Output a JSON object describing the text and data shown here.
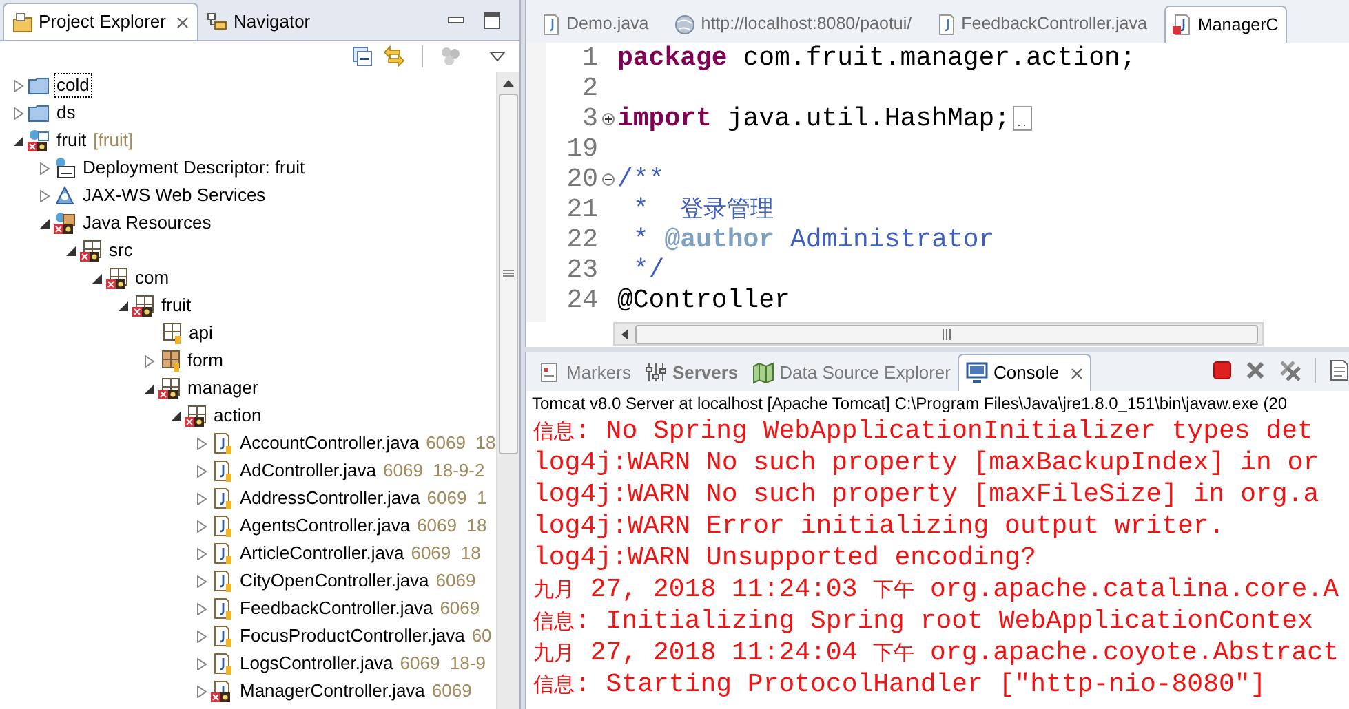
{
  "explorer": {
    "tabs": [
      {
        "label": "Project Explorer",
        "kind": "explorer",
        "selected": true,
        "closable": true
      },
      {
        "label": "Navigator",
        "kind": "navigator",
        "selected": false,
        "closable": false
      }
    ],
    "tree": [
      {
        "label": "cold",
        "kind": "folder",
        "has_children": true,
        "expanded": false,
        "focused": true,
        "error": false
      },
      {
        "label": "ds",
        "kind": "folder",
        "has_children": true,
        "expanded": false,
        "focused": false,
        "error": false
      },
      {
        "label": "fruit",
        "suffix": "[fruit]",
        "kind": "project",
        "has_children": true,
        "expanded": true,
        "focused": false,
        "error": true,
        "children": [
          {
            "label": "Deployment Descriptor: fruit",
            "kind": "descriptor",
            "has_children": true,
            "expanded": false,
            "focused": false,
            "error": false
          },
          {
            "label": "JAX-WS Web Services",
            "kind": "services",
            "has_children": true,
            "expanded": false,
            "focused": false,
            "error": false
          },
          {
            "label": "Java Resources",
            "kind": "resources",
            "has_children": true,
            "expanded": true,
            "focused": false,
            "error": true,
            "children": [
              {
                "label": "src",
                "kind": "package",
                "has_children": true,
                "expanded": true,
                "focused": false,
                "error": true,
                "children": [
                  {
                    "label": "com",
                    "kind": "package",
                    "has_children": true,
                    "expanded": true,
                    "focused": false,
                    "error": true,
                    "children": [
                      {
                        "label": "fruit",
                        "kind": "package",
                        "has_children": true,
                        "expanded": true,
                        "focused": false,
                        "error": true,
                        "children": [
                          {
                            "label": "api",
                            "kind": "package",
                            "has_children": false,
                            "focused": false,
                            "error": false
                          },
                          {
                            "label": "form",
                            "kind": "package",
                            "has_children": true,
                            "expanded": false,
                            "focused": false,
                            "error": false
                          },
                          {
                            "label": "manager",
                            "kind": "package",
                            "has_children": true,
                            "expanded": true,
                            "focused": false,
                            "error": true,
                            "children": [
                              {
                                "label": "action",
                                "kind": "package",
                                "has_children": true,
                                "expanded": true,
                                "focused": false,
                                "error": true,
                                "children": [
                                  {
                                    "label": "AccountController.java",
                                    "suffix": "6069  18",
                                    "kind": "file",
                                    "has_children": true,
                                    "expanded": false,
                                    "focused": false,
                                    "error": false
                                  },
                                  {
                                    "label": "AdController.java",
                                    "suffix": "6069  18-9-2",
                                    "kind": "file",
                                    "has_children": true,
                                    "expanded": false,
                                    "focused": false,
                                    "error": false
                                  },
                                  {
                                    "label": "AddressController.java",
                                    "suffix": "6069  1",
                                    "kind": "file",
                                    "has_children": true,
                                    "expanded": false,
                                    "focused": false,
                                    "error": false
                                  },
                                  {
                                    "label": "AgentsController.java",
                                    "suffix": "6069  18",
                                    "kind": "file",
                                    "has_children": true,
                                    "expanded": false,
                                    "focused": false,
                                    "error": false
                                  },
                                  {
                                    "label": "ArticleController.java",
                                    "suffix": "6069  18",
                                    "kind": "file",
                                    "has_children": true,
                                    "expanded": false,
                                    "focused": false,
                                    "error": false
                                  },
                                  {
                                    "label": "CityOpenController.java",
                                    "suffix": "6069",
                                    "kind": "file",
                                    "has_children": true,
                                    "expanded": false,
                                    "focused": false,
                                    "error": false
                                  },
                                  {
                                    "label": "FeedbackController.java",
                                    "suffix": "6069",
                                    "kind": "file",
                                    "has_children": true,
                                    "expanded": false,
                                    "focused": false,
                                    "error": false
                                  },
                                  {
                                    "label": "FocusProductController.java",
                                    "suffix": "60",
                                    "kind": "file",
                                    "has_children": true,
                                    "expanded": false,
                                    "focused": false,
                                    "error": false
                                  },
                                  {
                                    "label": "LogsController.java",
                                    "suffix": "6069  18-9",
                                    "kind": "file",
                                    "has_children": true,
                                    "expanded": false,
                                    "focused": false,
                                    "error": false
                                  },
                                  {
                                    "label": "ManagerController.java",
                                    "suffix": "6069",
                                    "kind": "file",
                                    "has_children": true,
                                    "expanded": false,
                                    "focused": false,
                                    "error": true
                                  }
                                ]
                              }
                            ]
                          }
                        ]
                      }
                    ]
                  }
                ]
              }
            ]
          }
        ]
      }
    ]
  },
  "editor": {
    "tabs": [
      {
        "label": "Demo.java",
        "kind": "java",
        "selected": false
      },
      {
        "label": "http://localhost:8080/paotui/",
        "kind": "web",
        "selected": false
      },
      {
        "label": "FeedbackController.java",
        "kind": "java",
        "selected": false
      },
      {
        "label": "ManagerC",
        "kind": "java-error",
        "selected": true
      }
    ],
    "lines": [
      {
        "number": "1",
        "fold_marker": false,
        "tokens": [
          {
            "kind": "keyword",
            "text": "package"
          },
          {
            "kind": "plain",
            "text": " com.fruit.manager.action;"
          }
        ]
      },
      {
        "number": "2",
        "fold_marker": false
      },
      {
        "number": "3",
        "fold_marker": true,
        "folded": true,
        "tokens": [
          {
            "kind": "keyword",
            "text": "import"
          },
          {
            "kind": "plain",
            "text": " java.util.HashMap;"
          }
        ]
      },
      {
        "number": "19",
        "fold_marker": false
      },
      {
        "number": "20",
        "fold_marker": true,
        "folded": false,
        "tokens": [
          {
            "kind": "comment",
            "text": "/**"
          }
        ]
      },
      {
        "number": "21",
        "fold_marker": false,
        "tokens": [
          {
            "kind": "comment",
            "text": " *  "
          },
          {
            "kind": "comment-cjk",
            "text": "登录管理"
          }
        ]
      },
      {
        "number": "22",
        "fold_marker": false,
        "tokens": [
          {
            "kind": "comment",
            "text": " * "
          },
          {
            "kind": "tag",
            "text": "@author"
          },
          {
            "kind": "comment",
            "text": " Administrator"
          }
        ]
      },
      {
        "number": "23",
        "fold_marker": false,
        "tokens": [
          {
            "kind": "comment",
            "text": " */"
          }
        ]
      },
      {
        "number": "24",
        "fold_marker": false,
        "tokens": [
          {
            "kind": "plain",
            "text": "@Controller"
          }
        ]
      }
    ]
  },
  "console": {
    "tabs": [
      {
        "label": "Markers",
        "kind": "markers",
        "selected": false,
        "bold": false,
        "closable": false
      },
      {
        "label": "Servers",
        "kind": "servers",
        "selected": false,
        "bold": true,
        "closable": false
      },
      {
        "label": "Data Source Explorer",
        "kind": "datasource",
        "selected": false,
        "bold": false,
        "closable": false
      },
      {
        "label": "Console",
        "kind": "console",
        "selected": true,
        "bold": false,
        "closable": true
      }
    ],
    "header": "Tomcat v8.0 Server at localhost [Apache Tomcat] C:\\Program Files\\Java\\jre1.8.0_151\\bin\\javaw.exe (20",
    "lines": [
      "信息: No Spring WebApplicationInitializer types det",
      "log4j:WARN No such property [maxBackupIndex] in or",
      "log4j:WARN No such property [maxFileSize] in org.a",
      "log4j:WARN Error initializing output writer.",
      "log4j:WARN Unsupported encoding?",
      "九月 27, 2018 11:24:03 下午 org.apache.catalina.core.A",
      "信息: Initializing Spring root WebApplicationContex",
      "九月 27, 2018 11:24:04 下午 org.apache.coyote.Abstract",
      "信息: Starting ProtocolHandler [\"http-nio-8080\"]"
    ]
  }
}
